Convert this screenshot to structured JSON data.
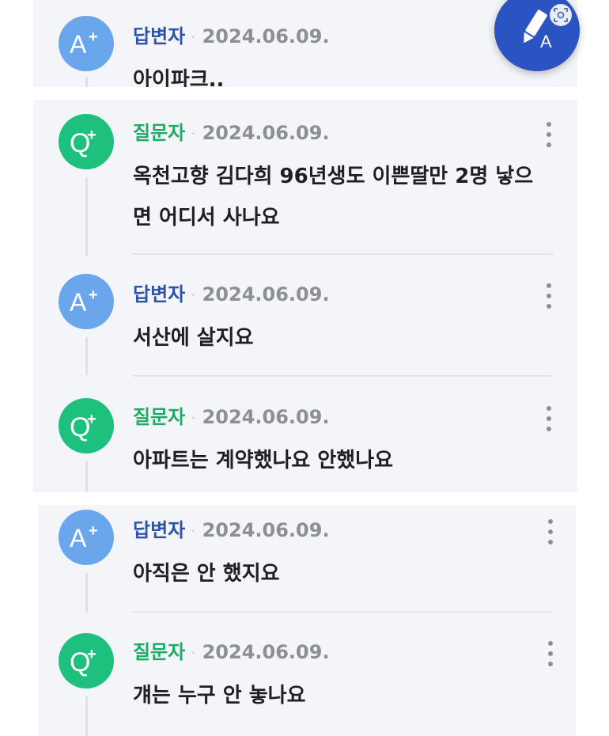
{
  "roles": {
    "answerer": "답변자",
    "questioner": "질문자"
  },
  "separator": "·",
  "messages": [
    {
      "role": "답변자",
      "date": "2024.06.09.",
      "text": "아이파크.."
    },
    {
      "role": "질문자",
      "date": "2024.06.09.",
      "text": "옥천고향 김다희 96년생도 이쁜딸만 2명 낳으면 어디서 사나요"
    },
    {
      "role": "답변자",
      "date": "2024.06.09.",
      "text": "서산에 살지요"
    },
    {
      "role": "질문자",
      "date": "2024.06.09.",
      "text": "아파트는 계약했나요 안했나요"
    },
    {
      "role": "답변자",
      "date": "2024.06.09.",
      "text": "아직은 안 했지요"
    },
    {
      "role": "질문자",
      "date": "2024.06.09.",
      "text": "걔는 누구 안 놓나요"
    }
  ],
  "icons": {
    "answer_avatar": "answerer-a-plus-icon",
    "question_avatar": "questioner-q-plus-icon",
    "more": "more-vertical-icon",
    "fab": "pencil-write-icon",
    "lens": "image-search-icon"
  },
  "colors": {
    "answerer_avatar": "#6aa6ec",
    "questioner_avatar": "#1ec07d",
    "answerer_label": "#2d54a8",
    "questioner_label": "#1eab65",
    "fab": "#2a54c1",
    "block_bg": "#f4f5f8"
  }
}
